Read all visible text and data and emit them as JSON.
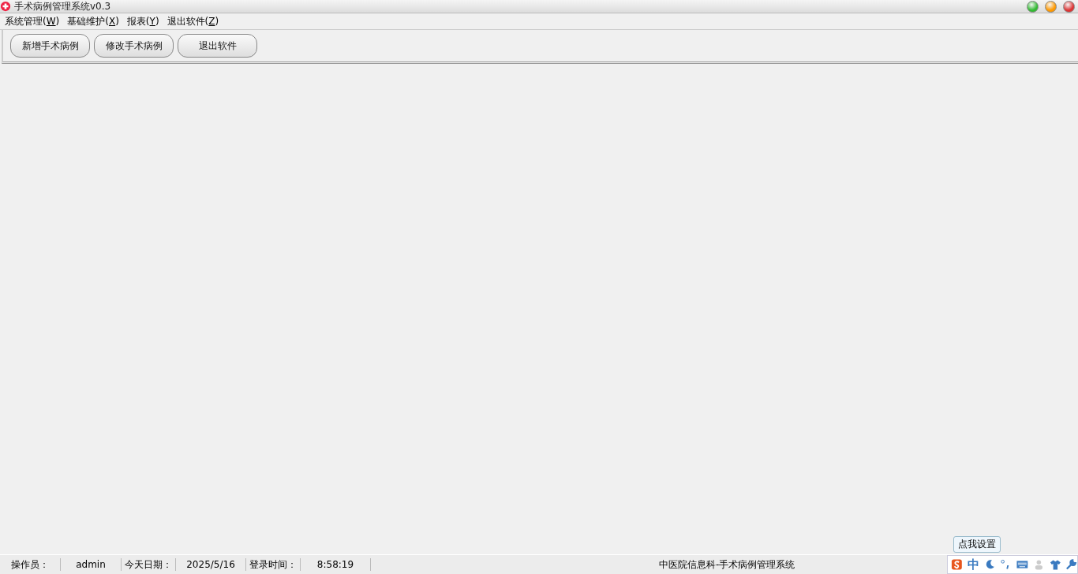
{
  "window": {
    "title": "手术病例管理系统v0.3"
  },
  "menu": [
    {
      "label": "系统管理(",
      "key": "W",
      "tail": ")"
    },
    {
      "label": "基础维护(",
      "key": "X",
      "tail": ")"
    },
    {
      "label": "报表(",
      "key": "Y",
      "tail": ")"
    },
    {
      "label": "退出软件(",
      "key": "Z",
      "tail": ")"
    }
  ],
  "toolbar": [
    "新增手术病例",
    "修改手术病例",
    "退出软件"
  ],
  "status_bar": [
    "操作员：",
    "admin",
    "今天日期：",
    "2025/5/16",
    "登录时间：",
    "8:58:19"
  ],
  "status_title": "中医院信息科-手术病例管理系统",
  "ime": {
    "tooltip": "点我设置",
    "mode": "中"
  }
}
